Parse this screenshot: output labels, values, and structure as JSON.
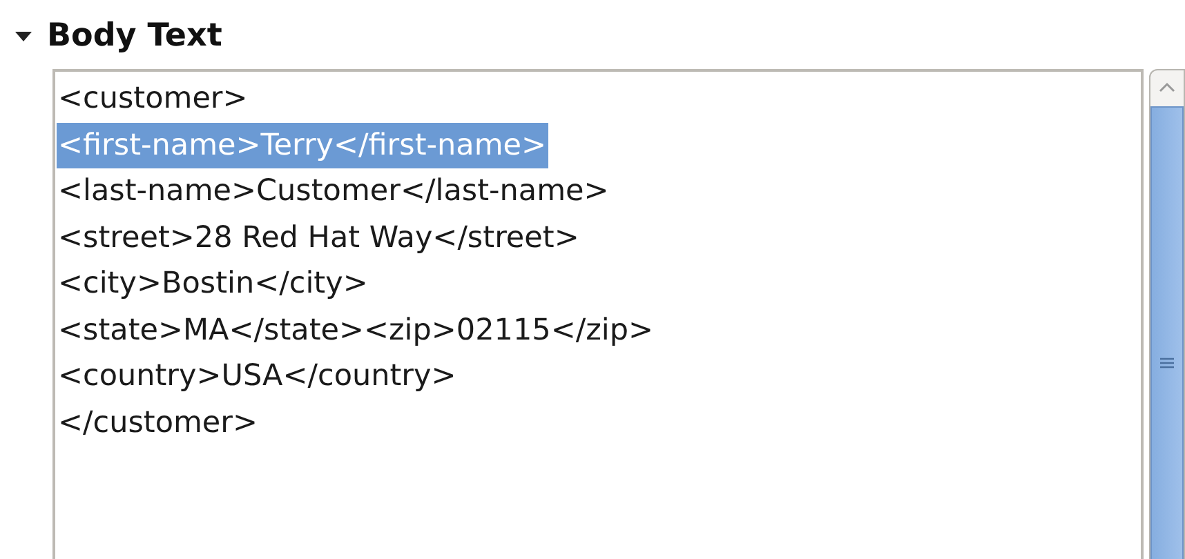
{
  "section": {
    "title": "Body Text",
    "expanded": true
  },
  "lines": [
    {
      "text": "<customer>",
      "selected": false
    },
    {
      "text": "<first-name>Terry</first-name>",
      "selected": true
    },
    {
      "text": "<last-name>Customer</last-name>",
      "selected": false
    },
    {
      "text": "<street>28 Red Hat Way</street>",
      "selected": false
    },
    {
      "text": "<city>Bostin</city>",
      "selected": false
    },
    {
      "text": "<state>MA</state><zip>02115</zip>",
      "selected": false
    },
    {
      "text": "<country>USA</country>",
      "selected": false
    },
    {
      "text": "</customer>",
      "selected": false
    }
  ]
}
